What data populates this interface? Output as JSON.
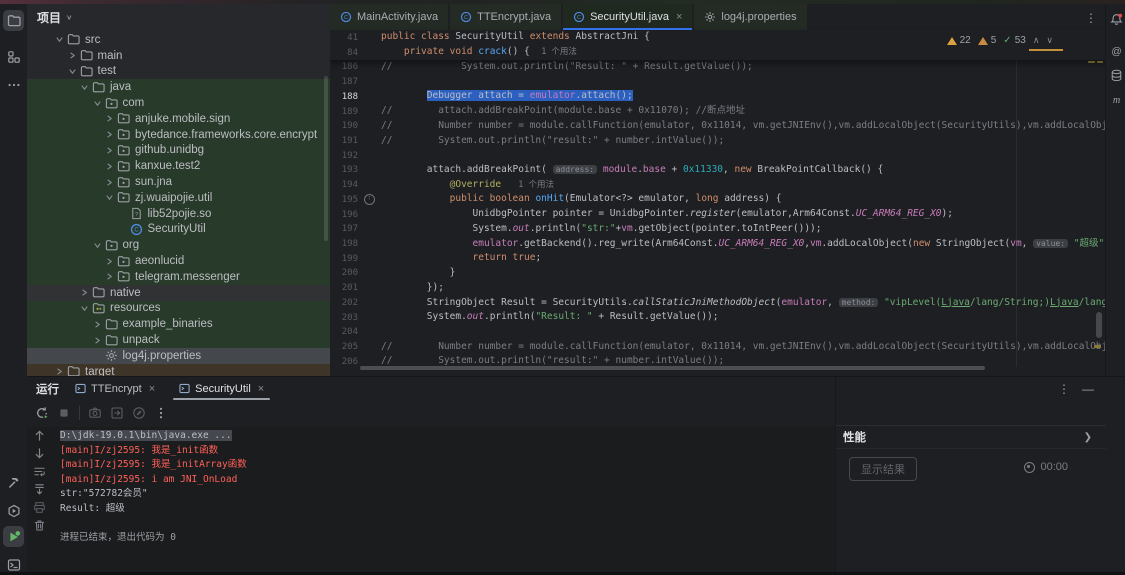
{
  "project_panel": {
    "title": "项目",
    "tree": [
      {
        "label": "src",
        "ind": 0,
        "chev": "open",
        "icon": "folder",
        "bg": ""
      },
      {
        "label": "main",
        "ind": 1,
        "chev": "closed",
        "icon": "folder",
        "bg": ""
      },
      {
        "label": "test",
        "ind": 1,
        "chev": "open",
        "icon": "folder",
        "bg": ""
      },
      {
        "label": "java",
        "ind": 2,
        "chev": "open",
        "icon": "folder",
        "bg": "green"
      },
      {
        "label": "com",
        "ind": 3,
        "chev": "open",
        "icon": "package",
        "bg": "green"
      },
      {
        "label": "anjuke.mobile.sign",
        "ind": 4,
        "chev": "closed",
        "icon": "package",
        "bg": "green"
      },
      {
        "label": "bytedance.frameworks.core.encrypt",
        "ind": 4,
        "chev": "closed",
        "icon": "package",
        "bg": "green"
      },
      {
        "label": "github.unidbg",
        "ind": 4,
        "chev": "closed",
        "icon": "package",
        "bg": "green"
      },
      {
        "label": "kanxue.test2",
        "ind": 4,
        "chev": "closed",
        "icon": "package",
        "bg": "green"
      },
      {
        "label": "sun.jna",
        "ind": 4,
        "chev": "closed",
        "icon": "package",
        "bg": "green"
      },
      {
        "label": "zj.wuaipojie.util",
        "ind": 4,
        "chev": "open",
        "icon": "package",
        "bg": "green"
      },
      {
        "label": "lib52pojie.so",
        "ind": 5,
        "chev": null,
        "icon": "so",
        "bg": "green"
      },
      {
        "label": "SecurityUtil",
        "ind": 5,
        "chev": null,
        "icon": "class",
        "bg": "green"
      },
      {
        "label": "org",
        "ind": 3,
        "chev": "open",
        "icon": "package",
        "bg": "green"
      },
      {
        "label": "aeonlucid",
        "ind": 4,
        "chev": "closed",
        "icon": "package",
        "bg": "green"
      },
      {
        "label": "telegram.messenger",
        "ind": 4,
        "chev": "closed",
        "icon": "package",
        "bg": "green"
      },
      {
        "label": "native",
        "ind": 2,
        "chev": "closed",
        "icon": "folder",
        "bg": "row"
      },
      {
        "label": "resources",
        "ind": 2,
        "chev": "open",
        "icon": "resources",
        "bg": "green"
      },
      {
        "label": "example_binaries",
        "ind": 3,
        "chev": "closed",
        "icon": "folder",
        "bg": "green"
      },
      {
        "label": "unpack",
        "ind": 3,
        "chev": "closed",
        "icon": "folder",
        "bg": "green"
      },
      {
        "label": "log4j.properties",
        "ind": 3,
        "chev": null,
        "icon": "gear",
        "bg": "selected"
      },
      {
        "label": "target",
        "ind": 0,
        "chev": "closed",
        "icon": "folder",
        "bg": "brown"
      }
    ]
  },
  "left_stripe": {
    "top": [
      {
        "name": "project-tool-button",
        "icon": "folder-tool",
        "active": true
      },
      {
        "name": "structure-tool-button",
        "icon": "structure",
        "active": false
      },
      {
        "name": "more-tool-windows-button",
        "icon": "more",
        "active": false
      }
    ],
    "bottom": [
      {
        "name": "build-tool-button",
        "icon": "hammer",
        "active": false
      },
      {
        "name": "services-tool-button",
        "icon": "services",
        "active": false
      },
      {
        "name": "run-tool-button",
        "icon": "run-play",
        "active": true
      },
      {
        "name": "terminal-tool-button",
        "icon": "terminal",
        "active": false
      }
    ]
  },
  "right_stripe": [
    {
      "name": "notifications-button",
      "icon": "bell"
    },
    {
      "name": "ai-assistant-button",
      "icon": "at"
    },
    {
      "name": "database-button",
      "icon": "database"
    },
    {
      "name": "maven-button",
      "icon": "maven"
    }
  ],
  "editor": {
    "tabs": [
      {
        "label": "MainActivity.java",
        "icon": "class",
        "active": false,
        "closable": false
      },
      {
        "label": "TTEncrypt.java",
        "icon": "class",
        "active": false,
        "closable": false
      },
      {
        "label": "SecurityUtil.java",
        "icon": "class",
        "active": true,
        "closable": true
      },
      {
        "label": "log4j.properties",
        "icon": "gear",
        "active": false,
        "closable": false
      }
    ],
    "tab_kebab": "⋮",
    "close_glyph": "×",
    "inspections": {
      "warnings": "22",
      "weak_warnings": "5",
      "passed": "53",
      "prev": "∧",
      "next": "∨"
    },
    "sticky": [
      {
        "n": "41",
        "tokens": [
          [
            "kw",
            "public class "
          ],
          [
            "def",
            "SecurityUtil "
          ],
          [
            "kw",
            "extends "
          ],
          [
            "def",
            "AbstractJni {"
          ]
        ]
      },
      {
        "n": "84",
        "tokens": [
          [
            "def",
            "    "
          ],
          [
            "kw",
            "private void "
          ],
          [
            "mth",
            "crack"
          ],
          [
            "def",
            "() {  "
          ],
          [
            "vision",
            "1 个用法"
          ]
        ]
      }
    ],
    "lines": [
      {
        "n": "186",
        "tokens": [
          [
            "com",
            "//            System.out.println(\"Result: \" + Result.getValue());"
          ]
        ]
      },
      {
        "n": "187",
        "tokens": []
      },
      {
        "n": "188",
        "cur": true,
        "tokens": [
          [
            "def",
            "        "
          ],
          [
            "def sel",
            "Debugger attach = "
          ],
          [
            "fld sel",
            "emulator"
          ],
          [
            "def sel",
            ".attach();"
          ]
        ]
      },
      {
        "n": "189",
        "tokens": [
          [
            "com",
            "//        attach.addBreakPoint(module.base + 0x11070); //断点地址"
          ]
        ]
      },
      {
        "n": "190",
        "tokens": [
          [
            "com",
            "//        Number number = module.callFunction(emulator, 0x11014, vm.getJNIEnv(),vm.addLocalObject(SecurityUtils),vm.addLocalObject(new St"
          ]
        ]
      },
      {
        "n": "191",
        "tokens": [
          [
            "com",
            "//        System.out.println(\"result:\" + number.intValue());"
          ]
        ]
      },
      {
        "n": "192",
        "tokens": []
      },
      {
        "n": "193",
        "tokens": [
          [
            "def",
            "        attach.addBreakPoint( "
          ],
          [
            "hint",
            "address:"
          ],
          [
            "def",
            " "
          ],
          [
            "fld",
            "module"
          ],
          [
            "def",
            "."
          ],
          [
            "fld",
            "base"
          ],
          [
            "def",
            " + "
          ],
          [
            "num",
            "0x11330"
          ],
          [
            "def",
            ", "
          ],
          [
            "kw",
            "new"
          ],
          [
            "def",
            " BreakPointCallback() {"
          ]
        ]
      },
      {
        "n": "194",
        "tokens": [
          [
            "def",
            "            "
          ],
          [
            "ann",
            "@Override"
          ],
          [
            "def",
            "   "
          ],
          [
            "vision",
            "1 个用法"
          ]
        ]
      },
      {
        "n": "195",
        "gutter": "override",
        "tokens": [
          [
            "def",
            "            "
          ],
          [
            "kw",
            "public boolean "
          ],
          [
            "mth",
            "onHit"
          ],
          [
            "def",
            "(Emulator<?> emulator, "
          ],
          [
            "kw",
            "long"
          ],
          [
            "def",
            " address) {"
          ]
        ]
      },
      {
        "n": "196",
        "tokens": [
          [
            "def",
            "                UnidbgPointer pointer = UnidbgPointer."
          ],
          [
            "smth",
            "register"
          ],
          [
            "def",
            "(emulator,Arm64Const."
          ],
          [
            "cst",
            "UC_ARM64_REG_X0"
          ],
          [
            "def",
            ");"
          ]
        ]
      },
      {
        "n": "197",
        "tokens": [
          [
            "def",
            "                System."
          ],
          [
            "sfld",
            "out"
          ],
          [
            "def",
            ".println("
          ],
          [
            "str",
            "\"str:\""
          ],
          [
            "def",
            "+"
          ],
          [
            "fld",
            "vm"
          ],
          [
            "def",
            ".getObject(pointer.toIntPeer()));"
          ]
        ]
      },
      {
        "n": "198",
        "tokens": [
          [
            "def",
            "                "
          ],
          [
            "fld",
            "emulator"
          ],
          [
            "def",
            ".getBackend().reg_write(Arm64Const."
          ],
          [
            "cst",
            "UC_ARM64_REG_X0"
          ],
          [
            "def",
            ","
          ],
          [
            "fld",
            "vm"
          ],
          [
            "def",
            ".addLocalObject("
          ],
          [
            "kw",
            "new"
          ],
          [
            "def",
            " StringObject("
          ],
          [
            "fld",
            "vm"
          ],
          [
            "def",
            ", "
          ],
          [
            "hint",
            "value:"
          ],
          [
            "def",
            " "
          ],
          [
            "str",
            "\"超级\""
          ],
          [
            "def",
            ")));"
          ]
        ]
      },
      {
        "n": "199",
        "tokens": [
          [
            "def",
            "                "
          ],
          [
            "kw",
            "return true"
          ],
          [
            "def",
            ";"
          ]
        ]
      },
      {
        "n": "200",
        "tokens": [
          [
            "def",
            "            }"
          ]
        ]
      },
      {
        "n": "201",
        "tokens": [
          [
            "def",
            "        });"
          ]
        ]
      },
      {
        "n": "202",
        "tokens": [
          [
            "def",
            "        StringObject Result = SecurityUtils."
          ],
          [
            "smth",
            "callStaticJniMethodObject"
          ],
          [
            "def",
            "("
          ],
          [
            "fld",
            "emulator"
          ],
          [
            "def",
            ", "
          ],
          [
            "hint",
            "method:"
          ],
          [
            "def",
            " "
          ],
          [
            "str",
            "\"vipLevel("
          ],
          [
            "lnk",
            "Ljava"
          ],
          [
            "str",
            "/lang/String;)"
          ],
          [
            "lnk",
            "Ljava"
          ],
          [
            "str",
            "/lang/String;\""
          ],
          [
            "def",
            ","
          ]
        ]
      },
      {
        "n": "203",
        "tokens": [
          [
            "def",
            "        System."
          ],
          [
            "sfld",
            "out"
          ],
          [
            "def",
            ".println("
          ],
          [
            "str",
            "\"Result: \""
          ],
          [
            "def",
            " + Result.getValue());"
          ]
        ]
      },
      {
        "n": "204",
        "tokens": []
      },
      {
        "n": "205",
        "tokens": [
          [
            "com",
            "//        Number number = module.callFunction(emulator, 0x11014, vm.getJNIEnv(),vm.addLocalObject(SecurityUtils),vm.addLocalObject(new "
          ]
        ]
      },
      {
        "n": "206",
        "tokens": [
          [
            "com",
            "//        System.out.println(\"result:\" + number.intValue());"
          ]
        ]
      }
    ]
  },
  "run_panel": {
    "title": "运行",
    "tabs": [
      {
        "label": "TTEncrypt",
        "active": false
      },
      {
        "label": "SecurityUtil",
        "active": true
      }
    ],
    "toolbar": [
      {
        "name": "rerun-button",
        "icon": "rerun"
      },
      {
        "name": "stop-button",
        "icon": "stop",
        "disabled": true
      },
      {
        "name": "separator",
        "icon": "sep"
      },
      {
        "name": "capture-snapshot-button",
        "icon": "camera",
        "disabled": true
      },
      {
        "name": "thread-dump-button",
        "icon": "import",
        "disabled": true
      },
      {
        "name": "edit-configuration-button",
        "icon": "editcircle",
        "disabled": true
      },
      {
        "name": "console-more-button",
        "icon": "kebab"
      }
    ],
    "gutter": [
      {
        "name": "prev-occurrence-button",
        "icon": "arrowup"
      },
      {
        "name": "next-occurrence-button",
        "icon": "arrowdown"
      },
      {
        "name": "soft-wrap-button",
        "icon": "softwrap"
      },
      {
        "name": "scroll-to-end-button",
        "icon": "scrollend"
      },
      {
        "name": "print-button",
        "icon": "printer",
        "disabled": true
      },
      {
        "name": "clear-all-button",
        "icon": "trash"
      }
    ],
    "console": [
      {
        "cls": "std",
        "sel": true,
        "text": "D:\\jdk-19.0.1\\bin\\java.exe ..."
      },
      {
        "cls": "err",
        "text": "[main]I/zj2595: 我是_init函数"
      },
      {
        "cls": "err",
        "text": "[main]I/zj2595: 我是_initArray函数"
      },
      {
        "cls": "err",
        "text": "[main]I/zj2595: i am JNI_OnLoad"
      },
      {
        "cls": "std",
        "text": "str:\"572782会员\""
      },
      {
        "cls": "std",
        "text": "Result: 超级"
      },
      {
        "cls": "std",
        "text": ""
      },
      {
        "cls": "dim",
        "text": "进程已结束，退出代码为 0"
      }
    ],
    "window_buttons": {
      "kebab": "⋮",
      "minimize": "—"
    }
  },
  "perf_panel": {
    "title": "性能",
    "chevron": "❯",
    "show_results_label": "显示结果",
    "timer": "00:00"
  },
  "misc": {
    "project_dropdown_chevron": "∨"
  }
}
